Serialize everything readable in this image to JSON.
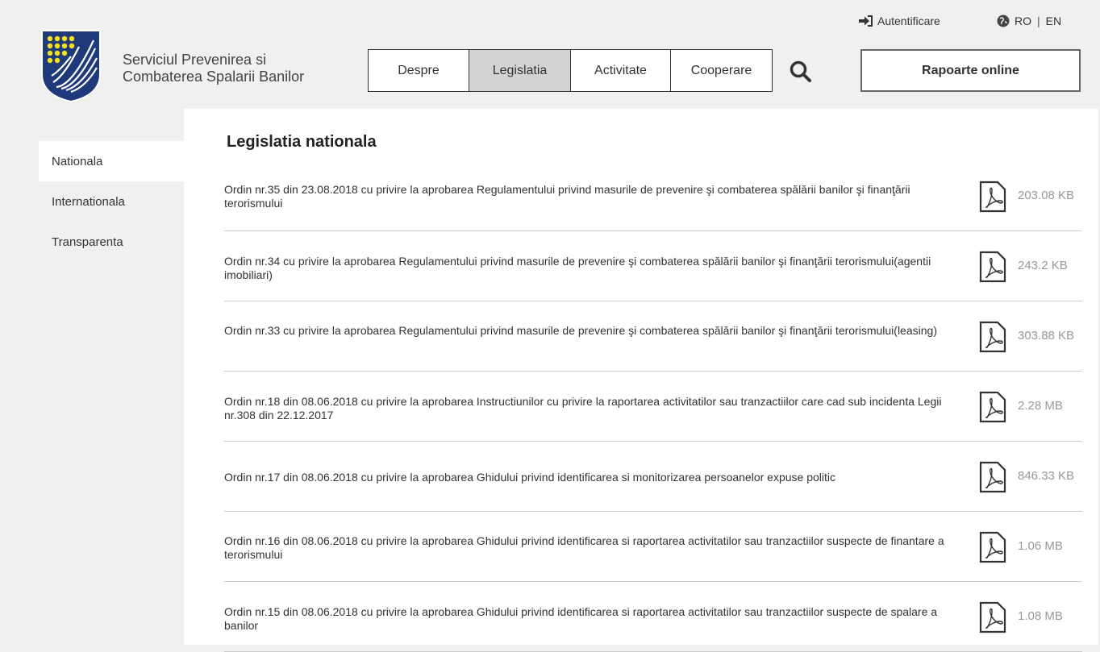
{
  "header": {
    "site_name": "Serviciul Prevenirea si\nCombaterea Spalarii Banilor",
    "auth_label": "Autentificare",
    "lang_ro": "RO",
    "lang_en": "EN",
    "report_button": "Rapoarte online",
    "nav": [
      {
        "label": "Despre"
      },
      {
        "label": "Legislatia"
      },
      {
        "label": "Activitate"
      },
      {
        "label": "Cooperare"
      }
    ],
    "active_nav": "Legislatia"
  },
  "sidebar": {
    "items": [
      {
        "label": "Nationala"
      },
      {
        "label": "Internationala"
      },
      {
        "label": "Transparenta"
      }
    ],
    "active_item": "Nationala"
  },
  "main": {
    "title": "Legislatia nationala",
    "documents": [
      {
        "title": "Ordin nr.35 din 23.08.2018 cu privire la aprobarea Regulamentului privind masurile de prevenire şi combaterea spălării banilor şi finanţării terorismului",
        "size": "203.08 KB"
      },
      {
        "title": "Ordin nr.34 cu privire la aprobarea Regulamentului privind masurile de prevenire şi combaterea spălării banilor şi finanţării terorismului(agentii imobiliari)",
        "size": "243.2 KB"
      },
      {
        "title": "Ordin nr.33 cu privire la aprobarea Regulamentului privind masurile de prevenire şi combaterea spălării banilor şi finanţării terorismului(leasing)",
        "size": "303.88 KB"
      },
      {
        "title": "Ordin nr.18 din 08.06.2018 cu privire la aprobarea Instructiunilor cu privire la raportarea activitatilor sau tranzactiilor care cad sub incidenta Legii nr.308 din 22.12.2017",
        "size": "2.28 MB"
      },
      {
        "title": "Ordin nr.17 din 08.06.2018 cu privire la aprobarea Ghidului privind identificarea si monitorizarea persoanelor expuse politic",
        "size": "846.33 KB"
      },
      {
        "title": "Ordin nr.16 din 08.06.2018 cu privire la aprobarea Ghidului privind identificarea si raportarea activitatilor sau tranzactiilor suspecte de finantare a terorismului",
        "size": "1.06 MB"
      },
      {
        "title": "Ordin nr.15 din 08.06.2018 cu privire la aprobarea Ghidului privind identificarea si raportarea activitatilor sau tranzactiilor suspecte de spalare a banilor",
        "size": "1.08 MB"
      }
    ]
  },
  "colors": {
    "logo_blue": "#1f3a7a",
    "logo_yellow": "#f4e11a",
    "active_nav_bg": "#d3d3d3",
    "size_text": "#999999"
  }
}
